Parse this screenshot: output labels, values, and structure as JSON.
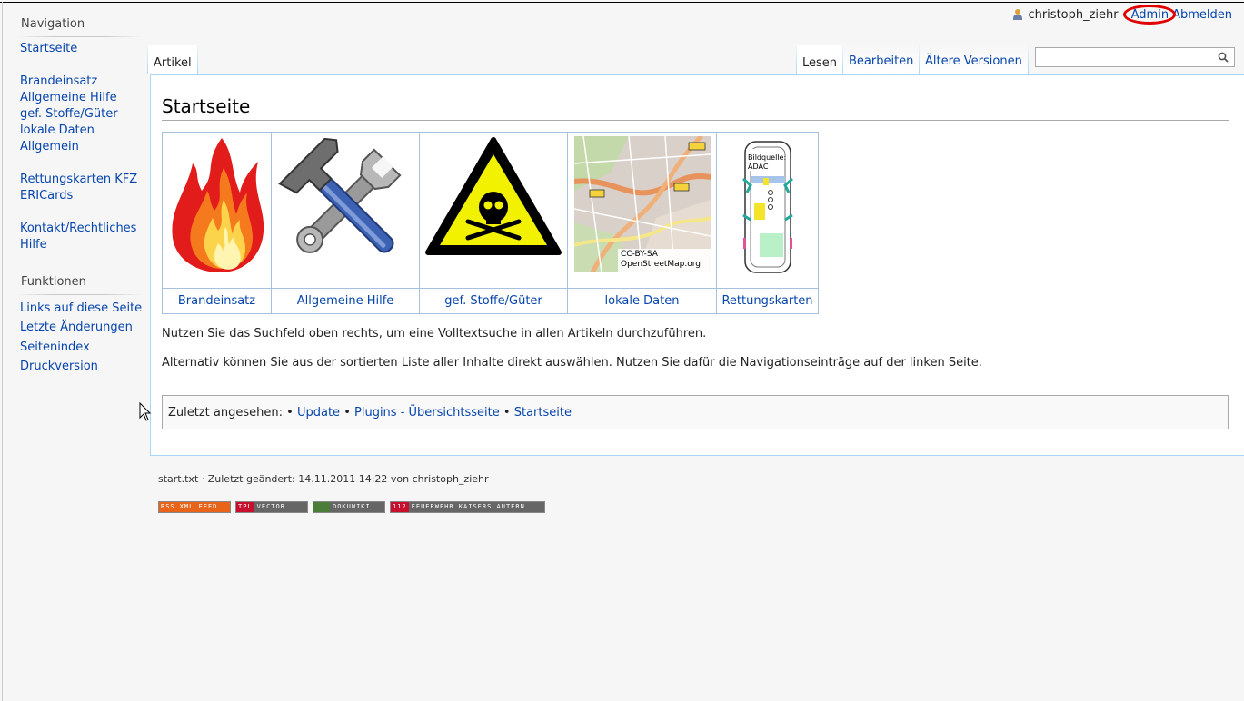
{
  "personal": {
    "username": "christoph_ziehr",
    "admin_label": "Admin",
    "logout_label": "Abmelden"
  },
  "sidebar": {
    "navigation_heading": "Navigation",
    "nav_items": [
      "Startseite",
      "Brandeinsatz",
      "Allgemeine Hilfe",
      "gef. Stoffe/Güter",
      "lokale Daten",
      "Allgemein",
      "Rettungskarten KFZ",
      "ERICards",
      "Kontakt/Rechtliches",
      "Hilfe"
    ],
    "functions_heading": "Funktionen",
    "function_items": [
      "Links auf diese Seite",
      "Letzte Änderungen",
      "Seitenindex",
      "Druckversion"
    ]
  },
  "tabs": {
    "article": "Artikel",
    "read": "Lesen",
    "edit": "Bearbeiten",
    "history": "Ältere Versionen"
  },
  "search": {
    "value": "",
    "placeholder": ""
  },
  "page": {
    "title": "Startseite",
    "tiles": [
      {
        "label": "Brandeinsatz",
        "icon": "fire-icon"
      },
      {
        "label": "Allgemeine Hilfe",
        "icon": "tools-icon"
      },
      {
        "label": "gef. Stoffe/Güter",
        "icon": "toxic-warning-icon"
      },
      {
        "label": "lokale Daten",
        "icon": "map-icon",
        "caption1": "CC-BY-SA",
        "caption2": "OpenStreetMap.org"
      },
      {
        "label": "Rettungskarten",
        "icon": "car-rescue-card-icon",
        "caption1": "Bildquelle:",
        "caption2": "ADAC"
      }
    ],
    "paragraph1": "Nutzen Sie das Suchfeld oben rechts, um eine Volltextsuche in allen Artikeln durchzuführen.",
    "paragraph2": "Alternativ können Sie aus der sortierten Liste aller Inhalte direkt auswählen. Nutzen Sie dafür die Navigationseinträge auf der linken Seite.",
    "breadcrumbs": {
      "label": "Zuletzt angesehen:",
      "items": [
        "Update",
        "Plugins - Übersichtsseite",
        "Startseite"
      ]
    }
  },
  "footer": {
    "info": "start.txt · Zuletzt geändert: 14.11.2011 14:22 von christoph_ziehr",
    "badges": [
      {
        "left": "RSS",
        "right": "XML FEED",
        "color": "#e8641b"
      },
      {
        "left": "TPL",
        "right": "VECTOR",
        "color": "#c8102e"
      },
      {
        "left": "",
        "right": "DOKUWIKI",
        "color": "#4a7d3a"
      },
      {
        "left": "112",
        "right": "FEUERWEHR KAISERSLAUTERN",
        "color": "#c8102e"
      }
    ]
  },
  "colors": {
    "link": "#0645ad",
    "admin_highlight": "#e00000",
    "content_border": "#a7d7f9"
  }
}
